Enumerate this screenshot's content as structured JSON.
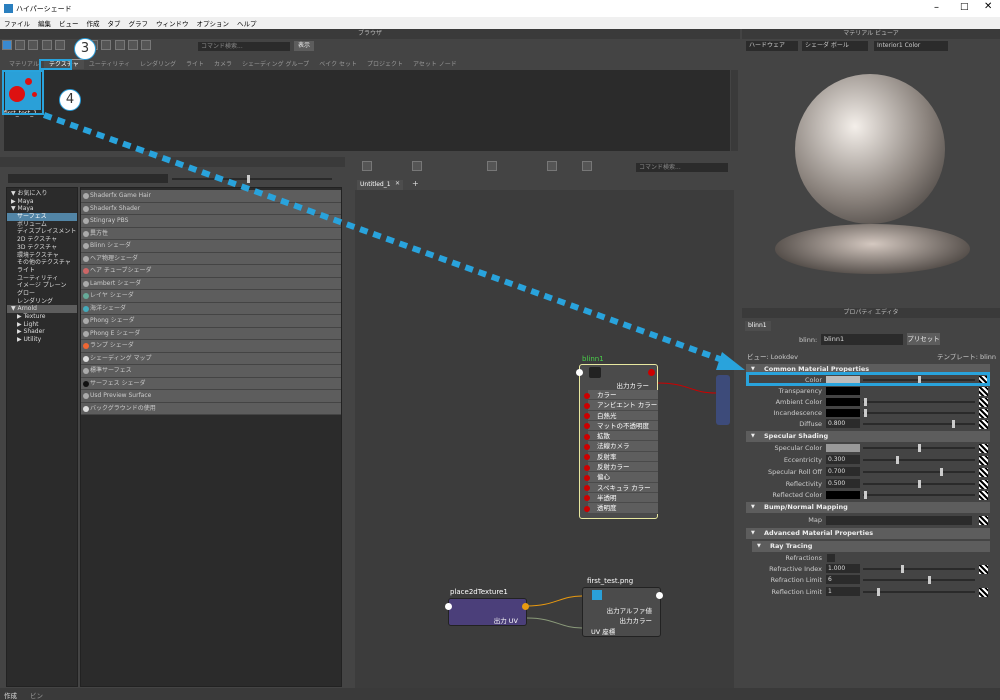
{
  "window": {
    "title": "ハイパーシェード"
  },
  "menu": [
    "ファイル",
    "編集",
    "ビュー",
    "作成",
    "タブ",
    "グラフ",
    "ウィンドウ",
    "オプション",
    "ヘルプ"
  ],
  "browser": {
    "header": "ブラウザ",
    "search_placeholder": "コマンド検索...",
    "show_label": "表示",
    "tabs": [
      "マテリアル",
      "テクスチャ",
      "ユーティリティ",
      "レンダリング",
      "ライト",
      "カメラ",
      "シェーディング グループ",
      "ベイク セット",
      "プロジェクト",
      "アセット ノード"
    ],
    "item": "first_test_1"
  },
  "create": {
    "categories": [
      {
        "label": "▼ お気に入り",
        "lvl": 0
      },
      {
        "label": "▶ Maya",
        "lvl": 0
      },
      {
        "label": "▼ Maya",
        "lvl": 0
      },
      {
        "label": "サーフェス",
        "lvl": 1,
        "sel": true
      },
      {
        "label": "ボリューム",
        "lvl": 1
      },
      {
        "label": "ディスプレイスメント",
        "lvl": 1
      },
      {
        "label": "2D テクスチャ",
        "lvl": 1
      },
      {
        "label": "3D テクスチャ",
        "lvl": 1
      },
      {
        "label": "環境テクスチャ",
        "lvl": 1
      },
      {
        "label": "その他のテクスチャ",
        "lvl": 1
      },
      {
        "label": "ライト",
        "lvl": 1
      },
      {
        "label": "ユーティリティ",
        "lvl": 1
      },
      {
        "label": "イメージ プレーン",
        "lvl": 1
      },
      {
        "label": "グロー",
        "lvl": 1
      },
      {
        "label": "レンダリング",
        "lvl": 1
      },
      {
        "label": "▼ Arnold",
        "lvl": 0,
        "hl": true
      },
      {
        "label": "▶ Texture",
        "lvl": 1
      },
      {
        "label": "▶ Light",
        "lvl": 1
      },
      {
        "label": "▶ Shader",
        "lvl": 1
      },
      {
        "label": "▶ Utility",
        "lvl": 1
      }
    ],
    "shaders": [
      {
        "label": "Shaderfx Game Hair",
        "color": "#aaa"
      },
      {
        "label": "Shaderfx Shader",
        "color": "#aaa"
      },
      {
        "label": "Stingray PBS",
        "color": "#aaa"
      },
      {
        "label": "異方性",
        "color": "#aaa"
      },
      {
        "label": "Blinn シェーダ",
        "color": "#aaa"
      },
      {
        "label": "ヘア物理シェーダ",
        "color": "#aaa"
      },
      {
        "label": "ヘア チューブシェーダ",
        "color": "#c66"
      },
      {
        "label": "Lambert シェーダ",
        "color": "#aaa"
      },
      {
        "label": "レイヤ シェーダ",
        "color": "#6a9"
      },
      {
        "label": "海洋シェーダ",
        "color": "#4ab"
      },
      {
        "label": "Phong シェーダ",
        "color": "#aaa"
      },
      {
        "label": "Phong E シェーダ",
        "color": "#aaa"
      },
      {
        "label": "ランプ シェーダ",
        "color": "#e63"
      },
      {
        "label": "シェーディング マップ",
        "color": "#ddd"
      },
      {
        "label": "標準サーフェス",
        "color": "#aaa"
      },
      {
        "label": "サーフェス シェーダ",
        "color": "#111"
      },
      {
        "label": "Usd Preview Surface",
        "color": "#aaa"
      },
      {
        "label": "バックグラウンドの使用",
        "color": "#ddd"
      }
    ]
  },
  "graph": {
    "tab": "Untitled_1",
    "search_placeholder": "コマンド検索...",
    "blinn": {
      "title": "blinn1",
      "out": "出力カラー",
      "attrs": [
        "カラー",
        "アンビエント カラー",
        "白熱光",
        "マットの不透明度",
        "拡散",
        "法線カメラ",
        "反射率",
        "反射カラー",
        "偏心",
        "スペキュラ カラー",
        "半透明",
        "透明度"
      ]
    },
    "place2d": {
      "title": "place2dTexture1",
      "out": "出力 UV"
    },
    "file": {
      "title": "first_test.png",
      "attrs": [
        "出力アルファ値",
        "出力カラー",
        "UV 座標"
      ]
    }
  },
  "material_viewer": {
    "header": "マテリアル ビューア",
    "renderer": "ハードウェア",
    "shape": "シェーダ ボール",
    "env": "Interior1 Color"
  },
  "property_editor": {
    "header": "プロパティ エディタ",
    "tab": "blinn1",
    "node_label": "blinn:",
    "node_name": "blinn1",
    "preset": "プリセット",
    "view": "ビュー: Lookdev",
    "template": "テンプレート: blinn",
    "sections": {
      "common": "Common Material Properties",
      "specular": "Specular Shading",
      "bump": "Bump/Normal Mapping",
      "advanced": "Advanced Material Properties",
      "ray": "Ray Tracing"
    },
    "rows": {
      "color": "Color",
      "transparency": "Transparency",
      "ambient": "Ambient Color",
      "incandescence": "Incandescence",
      "diffuse": "Diffuse",
      "diffuse_val": "0.800",
      "spec_color": "Specular Color",
      "ecc": "Eccentricity",
      "ecc_val": "0.300",
      "roll": "Specular Roll Off",
      "roll_val": "0.700",
      "refl": "Reflectivity",
      "refl_val": "0.500",
      "refl_color": "Reflected Color",
      "map": "Map",
      "refractions": "Refractions",
      "ri": "Refractive Index",
      "ri_val": "1.000",
      "rl": "Refraction Limit",
      "rl_val": "6",
      "rfl": "Reflection Limit",
      "rfl_val": "1"
    }
  },
  "callouts": {
    "c3": "3",
    "c4": "4"
  },
  "status": {
    "create": "作成",
    "bin": "ビン"
  },
  "colors": {
    "accent": "#29a3dc",
    "node_border": "#e8e8a0"
  }
}
